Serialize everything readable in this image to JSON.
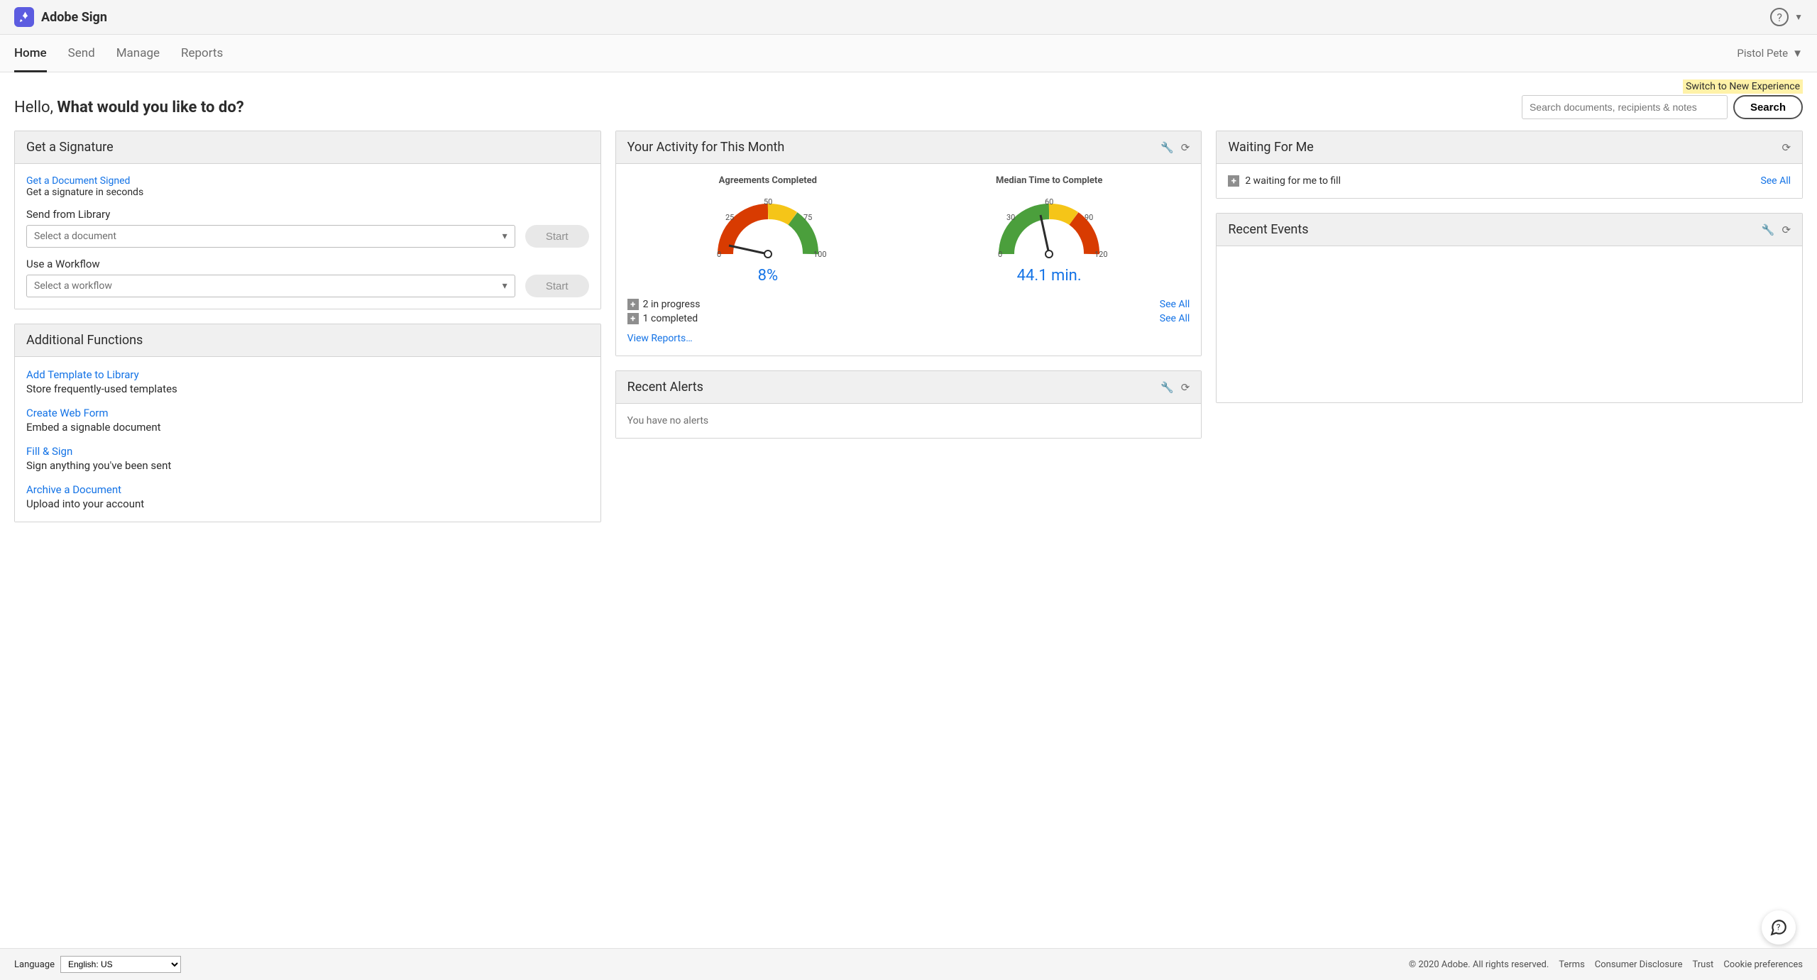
{
  "brand": {
    "name": "Adobe Sign"
  },
  "nav": {
    "tabs": [
      "Home",
      "Send",
      "Manage",
      "Reports"
    ],
    "active": 0,
    "user": "Pistol Pete"
  },
  "switch_link": "Switch to New Experience",
  "greeting": {
    "prefix": "Hello,",
    "bold": "What would you like to do?"
  },
  "search": {
    "placeholder": "Search documents, recipients & notes",
    "button": "Search"
  },
  "panels": {
    "signature": {
      "title": "Get a Signature",
      "get_signed_link": "Get a Document Signed",
      "get_signed_desc": "Get a signature in seconds",
      "send_library_label": "Send from Library",
      "select_document": "Select a document",
      "start": "Start",
      "workflow_label": "Use a Workflow",
      "select_workflow": "Select a workflow"
    },
    "additional": {
      "title": "Additional Functions",
      "items": [
        {
          "link": "Add Template to Library",
          "desc": "Store frequently-used templates"
        },
        {
          "link": "Create Web Form",
          "desc": "Embed a signable document"
        },
        {
          "link": "Fill & Sign",
          "desc": "Sign anything you've been sent"
        },
        {
          "link": "Archive a Document",
          "desc": "Upload into your account"
        }
      ]
    },
    "activity": {
      "title": "Your Activity for This Month",
      "gauges": [
        {
          "title": "Agreements Completed",
          "value": "8%",
          "ticks": [
            "0",
            "25",
            "50",
            "75",
            "100"
          ]
        },
        {
          "title": "Median Time to Complete",
          "value": "44.1 min.",
          "ticks": [
            "0",
            "30",
            "60",
            "90",
            "120"
          ]
        }
      ],
      "progress": "2 in progress",
      "completed": "1 completed",
      "see_all": "See All",
      "view_reports": "View Reports…"
    },
    "alerts": {
      "title": "Recent Alerts",
      "empty": "You have no alerts"
    },
    "waiting": {
      "title": "Waiting For Me",
      "text": "2 waiting for me to fill",
      "see_all": "See All"
    },
    "events": {
      "title": "Recent Events"
    }
  },
  "footer": {
    "language_label": "Language",
    "language_value": "English: US",
    "copyright": "© 2020 Adobe. All rights reserved.",
    "links": [
      "Terms",
      "Consumer Disclosure",
      "Trust",
      "Cookie preferences"
    ]
  },
  "chart_data": [
    {
      "type": "gauge",
      "title": "Agreements Completed",
      "value_pct": 8,
      "min": 0,
      "max": 100,
      "ticks": [
        0,
        25,
        50,
        75,
        100
      ],
      "segments": [
        {
          "from": 0,
          "to": 50,
          "color": "#d83b01"
        },
        {
          "from": 50,
          "to": 70,
          "color": "#f5c518"
        },
        {
          "from": 70,
          "to": 100,
          "color": "#4b9f3c"
        }
      ]
    },
    {
      "type": "gauge",
      "title": "Median Time to Complete",
      "value": 44.1,
      "unit": "min",
      "min": 0,
      "max": 120,
      "ticks": [
        0,
        30,
        60,
        90,
        120
      ],
      "segments": [
        {
          "from": 0,
          "to": 60,
          "color": "#4b9f3c"
        },
        {
          "from": 60,
          "to": 85,
          "color": "#f5c518"
        },
        {
          "from": 85,
          "to": 120,
          "color": "#d83b01"
        }
      ]
    }
  ]
}
